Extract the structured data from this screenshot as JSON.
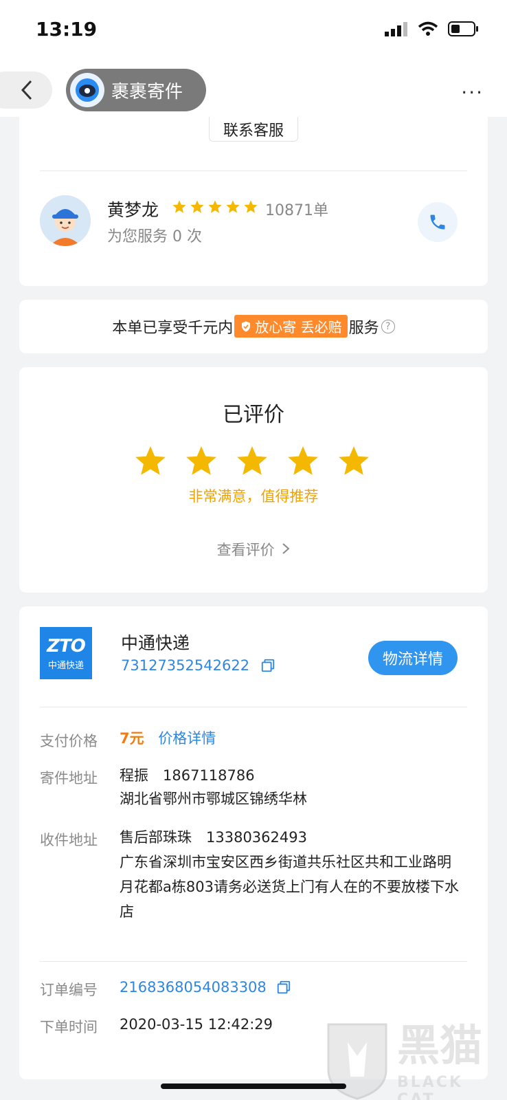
{
  "status_bar": {
    "time": "13:19"
  },
  "nav": {
    "title": "裹裹寄件",
    "more": "···"
  },
  "contact": {
    "label": "联系客服"
  },
  "courier": {
    "name": "黄梦龙",
    "rating_stars": 5,
    "orders": "10871单",
    "served": "为您服务 0 次"
  },
  "guarantee": {
    "prefix": "本单已享受千元内",
    "badge": "放心寄 丢必赔",
    "suffix": "服务",
    "help": "?"
  },
  "review": {
    "title": "已评价",
    "stars": 5,
    "comment": "非常满意，值得推荐",
    "view_label": "查看评价"
  },
  "shipment": {
    "logo_mark": "ZTO",
    "logo_sub": "中通快递",
    "company": "中通快递",
    "tracking_no": "73127352542622",
    "logistics_button": "物流详情",
    "pay_label": "支付价格",
    "price": "7元",
    "price_detail": "价格详情",
    "sender_label": "寄件地址",
    "sender_name_phone": "程振　1867118786",
    "sender_address": "湖北省鄂州市鄂城区锦绣华林",
    "receiver_label": "收件地址",
    "receiver_name_phone": "售后部珠珠　13380362493",
    "receiver_address": "广东省深圳市宝安区西乡街道共乐社区共和工业路明月花都a栋803请务必送货上门有人在的不要放楼下水店",
    "order_label": "订单编号",
    "order_no": "2168368054083308",
    "time_label": "下单时间",
    "order_time": "2020-03-15 12:42:29"
  },
  "watermark": {
    "text": "黑猫",
    "sub": "BLACK CAT"
  },
  "colors": {
    "accent_blue": "#2f95ee",
    "star_yellow": "#f5b800",
    "badge_orange": "#ff8a2b"
  }
}
